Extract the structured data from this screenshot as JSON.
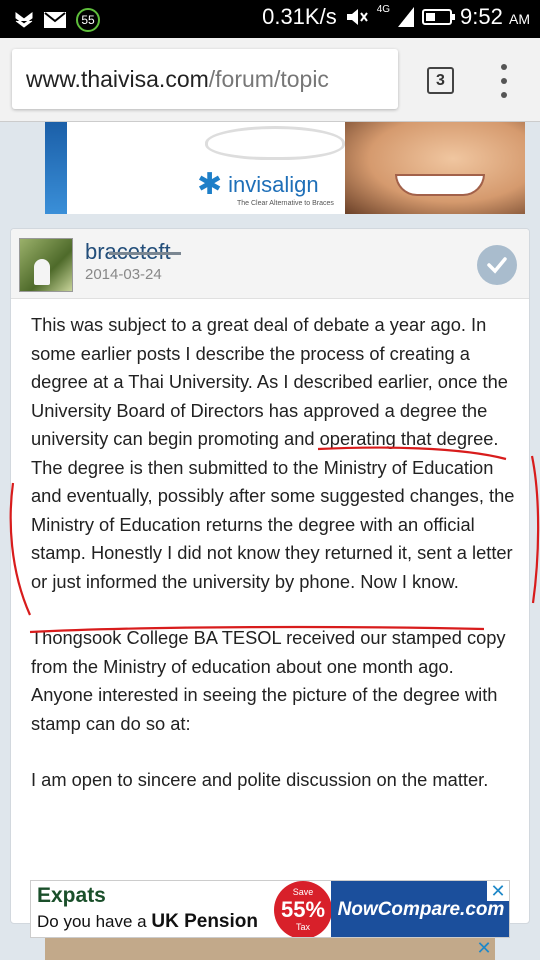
{
  "status_bar": {
    "badge": "55",
    "speed": "0.31K/s",
    "network": "4G",
    "time": "9:52",
    "ampm": "AM"
  },
  "browser": {
    "url_host": "www.thaivisa.com",
    "url_path": "/forum/topic",
    "tab_count": "3"
  },
  "ad_top": {
    "brand": "invisalign",
    "tagline": "The Clear Alternative to Braces"
  },
  "post": {
    "username": "braceteft",
    "date": "2014-03-24",
    "paragraphs": [
      "This was subject to a great deal of debate a year ago.  In some earlier posts I describe the process of creating a degree at a Thai University.  As I described earlier, once the University Board of Directors has approved a degree the university can begin promoting and operating that degree.  The degree is then submitted to the Ministry of Education and eventually, possibly after some suggested changes, the Ministry of Education returns the degree with an official stamp.  Honestly I did not know they returned it, sent a letter or just informed the university by phone.  Now I know.",
      "Thongsook College BA TESOL received our stamped copy from the Ministry of education about one month ago. Anyone interested in seeing the picture of the degree with stamp can do so at:",
      "I am open to sincere and polite discussion on the matter."
    ]
  },
  "ad_bottom": {
    "title": "Expats",
    "sub_prefix": "Do you have a ",
    "sub_bold": "UK Pension",
    "badge_top": "Save",
    "badge_value": "55%",
    "badge_bottom": "Tax",
    "brand": "NowCompare.com",
    "close": "✕"
  },
  "colors": {
    "annotation_red": "#d81c1c",
    "accent_blue": "#1e6fb8"
  }
}
